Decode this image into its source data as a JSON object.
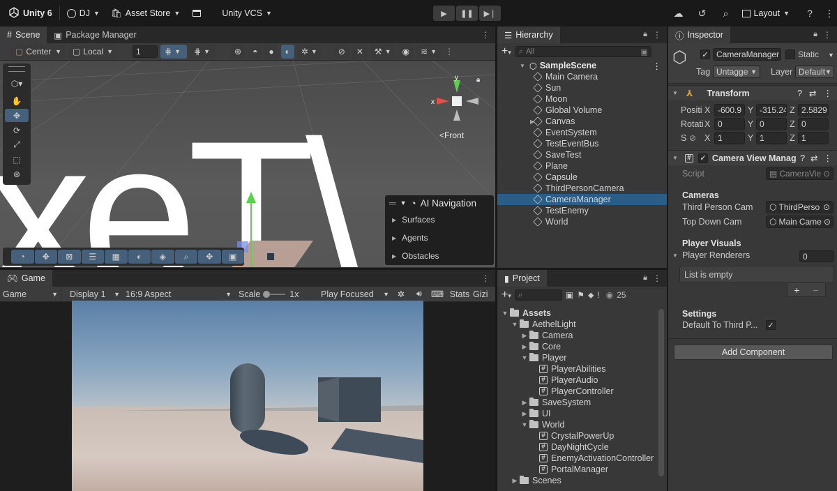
{
  "topbar": {
    "unity_label": "Unity 6",
    "account_label": "DJ",
    "asset_store_label": "Asset Store",
    "vcs_label": "Unity VCS",
    "layout_label": "Layout"
  },
  "scene": {
    "tabs": [
      {
        "label": "Scene"
      },
      {
        "label": "Package Manager"
      }
    ],
    "pivot_label": "Center",
    "space_label": "Local",
    "grid_value": "1",
    "orientation_label": "Front",
    "gizmo_axes": {
      "x": "x",
      "y": "y"
    },
    "scene_text": "xeT\\"
  },
  "ai_navigation": {
    "title": "AI Navigation",
    "items": [
      "Surfaces",
      "Agents",
      "Obstacles"
    ]
  },
  "game": {
    "tab_label": "Game",
    "view_label": "Game",
    "display_label": "Display 1",
    "aspect_label": "16:9 Aspect",
    "scale_label": "Scale",
    "scale_value": "1x",
    "play_mode_label": "Play Focused",
    "stats_label": "Stats",
    "gizmos_label": "Gizi"
  },
  "hierarchy": {
    "tab_label": "Hierarchy",
    "search_placeholder": "All",
    "scene_name": "SampleScene",
    "items": [
      {
        "label": "Main Camera"
      },
      {
        "label": "Sun"
      },
      {
        "label": "Moon"
      },
      {
        "label": "Global Volume"
      },
      {
        "label": "Canvas"
      },
      {
        "label": "EventSystem"
      },
      {
        "label": "TestEventBus"
      },
      {
        "label": "SaveTest"
      },
      {
        "label": "Plane"
      },
      {
        "label": "Capsule"
      },
      {
        "label": "ThirdPersonCamera"
      },
      {
        "label": "CameraManager"
      },
      {
        "label": "TestEnemy"
      },
      {
        "label": "World"
      }
    ],
    "selected": "CameraManager"
  },
  "project": {
    "tab_label": "Project",
    "hidden_count": "25",
    "tree": [
      {
        "label": "Assets",
        "kind": "folder",
        "depth": 0,
        "expanded": true
      },
      {
        "label": "AethelLight",
        "kind": "folder",
        "depth": 1,
        "expanded": true
      },
      {
        "label": "Camera",
        "kind": "folder",
        "depth": 2,
        "expanded": false
      },
      {
        "label": "Core",
        "kind": "folder",
        "depth": 2,
        "expanded": false
      },
      {
        "label": "Player",
        "kind": "folder",
        "depth": 2,
        "expanded": true
      },
      {
        "label": "PlayerAbilities",
        "kind": "script",
        "depth": 3
      },
      {
        "label": "PlayerAudio",
        "kind": "script",
        "depth": 3
      },
      {
        "label": "PlayerController",
        "kind": "script",
        "depth": 3
      },
      {
        "label": "SaveSystem",
        "kind": "folder",
        "depth": 2,
        "expanded": false
      },
      {
        "label": "UI",
        "kind": "folder",
        "depth": 2,
        "expanded": false
      },
      {
        "label": "World",
        "kind": "folder",
        "depth": 2,
        "expanded": true
      },
      {
        "label": "CrystalPowerUp",
        "kind": "script",
        "depth": 3
      },
      {
        "label": "DayNightCycle",
        "kind": "script",
        "depth": 3
      },
      {
        "label": "EnemyActivationController",
        "kind": "script",
        "depth": 3
      },
      {
        "label": "PortalManager",
        "kind": "script",
        "depth": 3
      },
      {
        "label": "Scenes",
        "kind": "folder",
        "depth": 1,
        "expanded": false
      }
    ]
  },
  "inspector": {
    "tab_label": "Inspector",
    "object_name": "CameraManager",
    "static_label": "Static",
    "tag_label": "Tag",
    "tag_value": "Untagge",
    "layer_label": "Layer",
    "layer_value": "Default",
    "transform": {
      "title": "Transform",
      "position_label": "Positi",
      "rotation_label": "Rotati",
      "scale_label": "S",
      "position": {
        "x": "-600.9",
        "y": "-315.24",
        "z": "2.5829"
      },
      "rotation": {
        "x": "0",
        "y": "0",
        "z": "0"
      },
      "scale": {
        "x": "1",
        "y": "1",
        "z": "1"
      },
      "axis_x": "X",
      "axis_y": "Y",
      "axis_z": "Z"
    },
    "component": {
      "title": "Camera View Manag",
      "script_label": "Script",
      "script_value": "CameraVie",
      "cameras_header": "Cameras",
      "third_person_label": "Third Person Cam",
      "third_person_value": "ThirdPerso",
      "top_down_label": "Top Down Cam",
      "top_down_value": "Main Came",
      "visuals_header": "Player Visuals",
      "renderers_label": "Player Renderers",
      "renderers_count": "0",
      "empty_list": "List is empty",
      "settings_header": "Settings",
      "default_label": "Default To Third P...",
      "default_checked": true
    },
    "add_component_label": "Add Component"
  }
}
